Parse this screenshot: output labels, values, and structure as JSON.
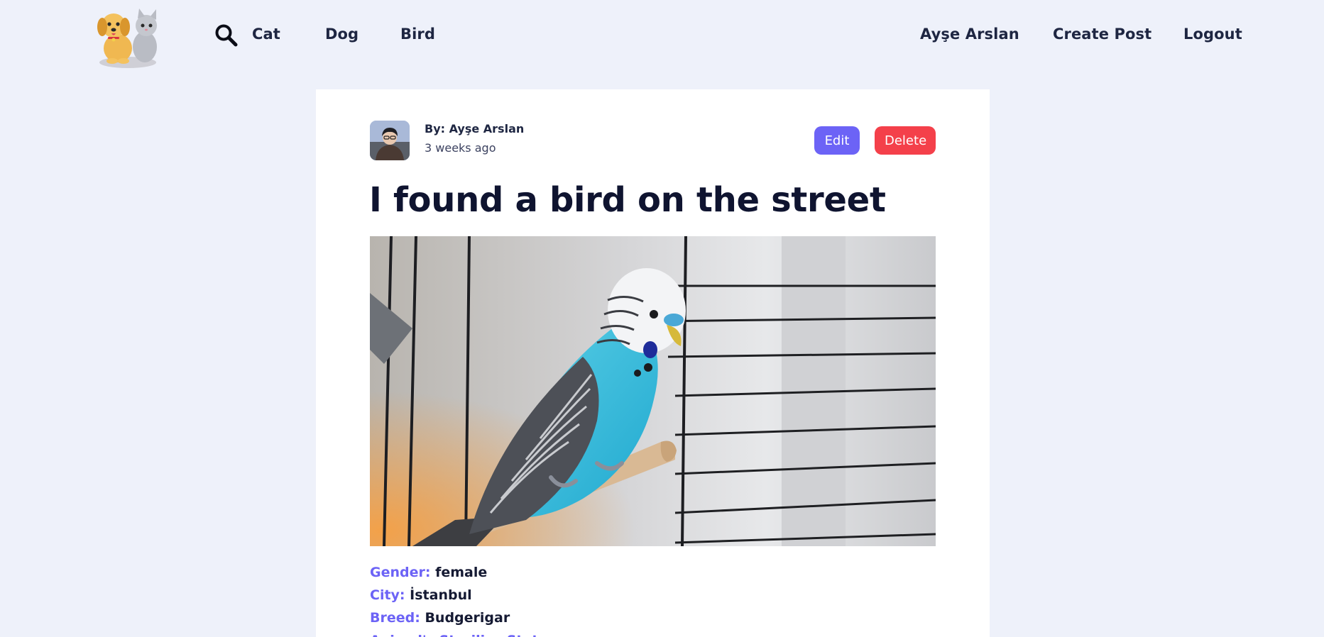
{
  "navbar": {
    "logo_icon": "dog-and-cat-logo-icon",
    "search_icon": "search-icon",
    "links": {
      "cat": "Cat",
      "dog": "Dog",
      "bird": "Bird",
      "user": "Ayşe Arslan",
      "create_post": "Create Post",
      "logout": "Logout"
    }
  },
  "post": {
    "author_label": "By: Ayşe Arslan",
    "time_ago": "3 weeks ago",
    "avatar_icon": "user-avatar-photo",
    "edit_label": "Edit",
    "delete_label": "Delete",
    "title": "I found a bird on the street",
    "image_icon": "budgerigar-photo",
    "details": [
      {
        "key": "Gender:",
        "value": "female"
      },
      {
        "key": "City:",
        "value": "İstanbul"
      },
      {
        "key": "Breed:",
        "value": "Budgerigar"
      },
      {
        "key": "Animal's Sterilize Status:",
        "value": ""
      }
    ]
  },
  "colors": {
    "background": "#eef1fa",
    "accent": "#6c63f6",
    "danger": "#f4404a",
    "card": "#ffffff"
  }
}
